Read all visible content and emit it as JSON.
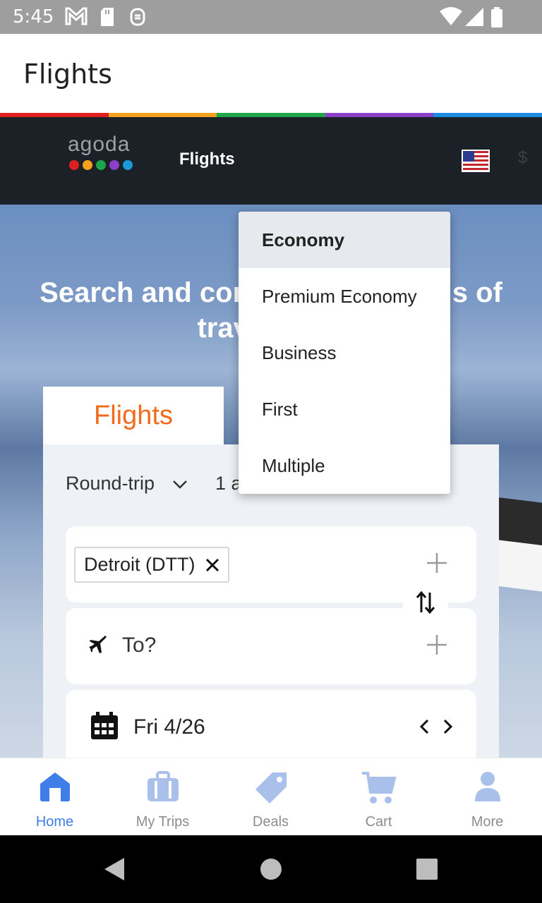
{
  "status_bar": {
    "time": "5:45"
  },
  "app_bar": {
    "title": "Flights"
  },
  "header": {
    "logo": "agoda",
    "nav_title": "Flights",
    "currency": "$"
  },
  "hero": {
    "heading_line1": "Search and compare thousands of",
    "heading_line2": "travel sites"
  },
  "tabs": {
    "flights": "Flights"
  },
  "search": {
    "trip_type": "Round-trip",
    "passengers": "1 adult",
    "from_chip": "Detroit (DTT)",
    "to_placeholder": "To?",
    "date": "Fri 4/26"
  },
  "cabin_dropdown": {
    "selected": "Economy",
    "options": [
      "Economy",
      "Premium Economy",
      "Business",
      "First",
      "Multiple"
    ]
  },
  "bottom_nav": [
    {
      "label": "Home",
      "icon": "home-icon",
      "active": true
    },
    {
      "label": "My Trips",
      "icon": "briefcase-icon",
      "active": false
    },
    {
      "label": "Deals",
      "icon": "tag-icon",
      "active": false
    },
    {
      "label": "Cart",
      "icon": "cart-icon",
      "active": false
    },
    {
      "label": "More",
      "icon": "person-icon",
      "active": false
    }
  ],
  "colors": {
    "accent_orange": "#f26a1b",
    "active_blue": "#3f7de8",
    "header_dark": "#1b2127",
    "rainbow": [
      "#e02020",
      "#f3a11d",
      "#1fa64b",
      "#8c3fc7",
      "#1a8ce0"
    ]
  }
}
